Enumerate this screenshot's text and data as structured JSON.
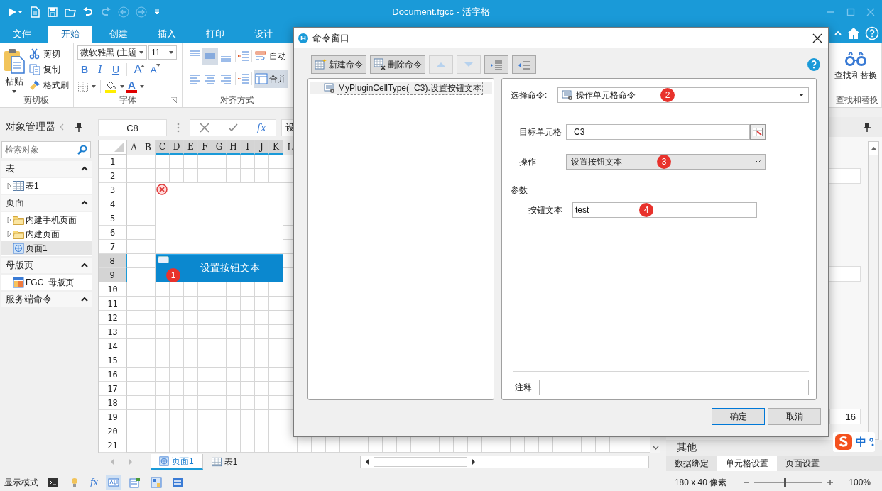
{
  "title_bar": {
    "title": "Document.fgcc - 活字格",
    "quick_access": [
      {
        "disabled": false
      },
      {
        "disabled": false
      },
      {
        "disabled": false
      },
      {
        "disabled": false
      },
      {
        "disabled": false
      },
      {
        "disabled": true
      },
      {
        "disabled": true
      },
      {
        "disabled": true
      }
    ]
  },
  "ribbon_tabs": [
    {
      "label": "文件",
      "selected": false
    },
    {
      "label": "开始",
      "selected": true
    },
    {
      "label": "创建",
      "selected": false
    },
    {
      "label": "插入",
      "selected": false
    },
    {
      "label": "打印",
      "selected": false
    },
    {
      "label": "设计",
      "selected": false
    }
  ],
  "ribbon": {
    "clipboard": {
      "label": "剪切板",
      "paste": "粘贴",
      "cut": "剪切",
      "copy": "复制",
      "format_painter": "格式刷"
    },
    "font": {
      "label": "字体",
      "font_name": "微软雅黑 (主题",
      "font_size": "11",
      "style_buttons": [
        {
          "label": "B",
          "kind": "bold"
        },
        {
          "label": "I",
          "kind": "italic"
        },
        {
          "label": "U",
          "kind": "underline"
        },
        {
          "label": "A",
          "kind": "grow"
        },
        {
          "label": "A",
          "kind": "shrink"
        }
      ],
      "font_color": "A"
    },
    "alignment": {
      "label": "对齐方式",
      "buttons": [
        {
          "selected": false
        },
        {
          "selected": true
        },
        {
          "selected": false
        },
        {
          "selected": false
        },
        {
          "selected": false
        },
        {
          "selected": false
        }
      ],
      "wrap_text": {
        "label": "自动",
        "selected": false
      },
      "merge": {
        "label": "合并",
        "selected": true
      }
    },
    "find": {
      "button": "查找和替换",
      "label": "查找和替换"
    }
  },
  "object_manager": {
    "title": "对象管理器",
    "search": {
      "placeholder": "检索对象"
    },
    "sections": [
      {
        "title": "表",
        "expanded": true,
        "items": [
          {
            "label": "表1",
            "kind": "table",
            "expandable": true,
            "selected": false
          }
        ]
      },
      {
        "title": "页面",
        "expanded": true,
        "items": [
          {
            "label": "内建手机页面",
            "kind": "folder",
            "expandable": true,
            "selected": false
          },
          {
            "label": "内建页面",
            "kind": "folder",
            "expandable": true,
            "selected": false
          },
          {
            "label": "页面1",
            "kind": "page",
            "expandable": false,
            "selected": true
          }
        ]
      },
      {
        "title": "母版页",
        "expanded": true,
        "items": [
          {
            "label": "FGC_母版页",
            "kind": "master",
            "expandable": false,
            "selected": false
          }
        ]
      },
      {
        "title": "服务端命令",
        "expanded": true
      }
    ]
  },
  "formula_bar": {
    "name_box": "C8",
    "fx": "fx",
    "formula": "设"
  },
  "sheet": {
    "columns": [
      {
        "label": "A",
        "selected": false
      },
      {
        "label": "B",
        "selected": false
      },
      {
        "label": "C",
        "selected": true
      },
      {
        "label": "D",
        "selected": true
      },
      {
        "label": "E",
        "selected": true
      },
      {
        "label": "F",
        "selected": true
      },
      {
        "label": "G",
        "selected": true
      },
      {
        "label": "H",
        "selected": true
      },
      {
        "label": "I",
        "selected": true
      },
      {
        "label": "J",
        "selected": true
      },
      {
        "label": "K",
        "selected": true
      },
      {
        "label": "L",
        "selected": false
      }
    ],
    "rows": [
      {
        "label": "1",
        "selected": false
      },
      {
        "label": "2",
        "selected": false
      },
      {
        "label": "3",
        "selected": false
      },
      {
        "label": "4",
        "selected": false
      },
      {
        "label": "5",
        "selected": false
      },
      {
        "label": "6",
        "selected": false
      },
      {
        "label": "7",
        "selected": false
      },
      {
        "label": "8",
        "selected": true
      },
      {
        "label": "9",
        "selected": true
      },
      {
        "label": "10",
        "selected": false
      },
      {
        "label": "11",
        "selected": false
      },
      {
        "label": "12",
        "selected": false
      },
      {
        "label": "13",
        "selected": false
      },
      {
        "label": "14",
        "selected": false
      },
      {
        "label": "15",
        "selected": false
      },
      {
        "label": "16",
        "selected": false
      },
      {
        "label": "17",
        "selected": false
      },
      {
        "label": "18",
        "selected": false
      },
      {
        "label": "19",
        "selected": false
      },
      {
        "label": "20",
        "selected": false
      },
      {
        "label": "21",
        "selected": false
      }
    ],
    "cells": [
      {
        "kind": "error"
      },
      {
        "kind": "button",
        "text": "设置按钮文本",
        "badge": "1"
      }
    ]
  },
  "sheet_tabs": [
    {
      "label": "页面1",
      "kind": "page",
      "selected": true
    },
    {
      "label": "表1",
      "kind": "table",
      "selected": false
    }
  ],
  "properties_panel": {
    "value_field": "16",
    "section": "其他",
    "tabs": [
      {
        "label": "数据绑定",
        "selected": false
      },
      {
        "label": "单元格设置",
        "selected": true
      },
      {
        "label": "页面设置",
        "selected": false
      }
    ]
  },
  "status_bar": {
    "mode": "显示模式",
    "tools": [
      {
        "selected": false
      },
      {
        "selected": false
      },
      {
        "label": "fx",
        "selected": false
      },
      {
        "selected": true
      },
      {
        "selected": false
      },
      {
        "selected": false
      },
      {
        "selected": false
      }
    ],
    "size": "180 x 40 像素",
    "zoom": {
      "level": 0.45,
      "reading": "100%"
    }
  },
  "dialog": {
    "title": "命令窗口",
    "toolbar": [
      {
        "label": "新建命令",
        "disabled": false
      },
      {
        "label": "删除命令",
        "disabled": false
      },
      {
        "disabled": true
      },
      {
        "disabled": true
      },
      {
        "disabled": false
      },
      {
        "disabled": false
      }
    ],
    "commands": [
      {
        "label": "MyPluginCellType(=C3).设置按钮文本",
        "selected": true
      }
    ],
    "select_command": {
      "label": "选择命令:",
      "value": "操作单元格命令",
      "badge": "2"
    },
    "target_cell": {
      "label": "目标单元格",
      "value": "=C3"
    },
    "operation": {
      "label": "操作",
      "value": "设置按钮文本",
      "badge": "3"
    },
    "parameters": {
      "label": "参数",
      "fields": [
        {
          "label": "按钮文本",
          "value": "test",
          "badge": "4"
        }
      ]
    },
    "note": {
      "label": "注释"
    },
    "buttons": [
      {
        "label": "确定",
        "default": true
      },
      {
        "label": "取消",
        "default": false
      }
    ]
  },
  "ime": {
    "mode": "中"
  }
}
